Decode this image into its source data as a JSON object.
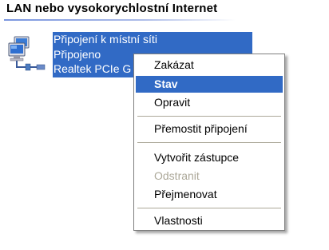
{
  "group": {
    "title": "LAN nebo vysokorychlostní Internet"
  },
  "connection": {
    "name": "Připojení k místní síti",
    "status": "Připojeno",
    "device": "Realtek PCIe G",
    "icon": "network-connection-icon"
  },
  "context_menu": {
    "items": [
      {
        "label": "Zakázat",
        "state": "normal"
      },
      {
        "label": "Stav",
        "state": "selected"
      },
      {
        "label": "Opravit",
        "state": "normal"
      },
      {
        "label": "Přemostit připojení",
        "state": "normal"
      },
      {
        "label": "Vytvořit zástupce",
        "state": "normal"
      },
      {
        "label": "Odstranit",
        "state": "disabled"
      },
      {
        "label": "Přejmenovat",
        "state": "normal"
      },
      {
        "label": "Vlastnosti",
        "state": "normal"
      }
    ]
  },
  "colors": {
    "selection": "#316ac5",
    "disabled_text": "#aca899",
    "header_rule": "#7a96df"
  }
}
